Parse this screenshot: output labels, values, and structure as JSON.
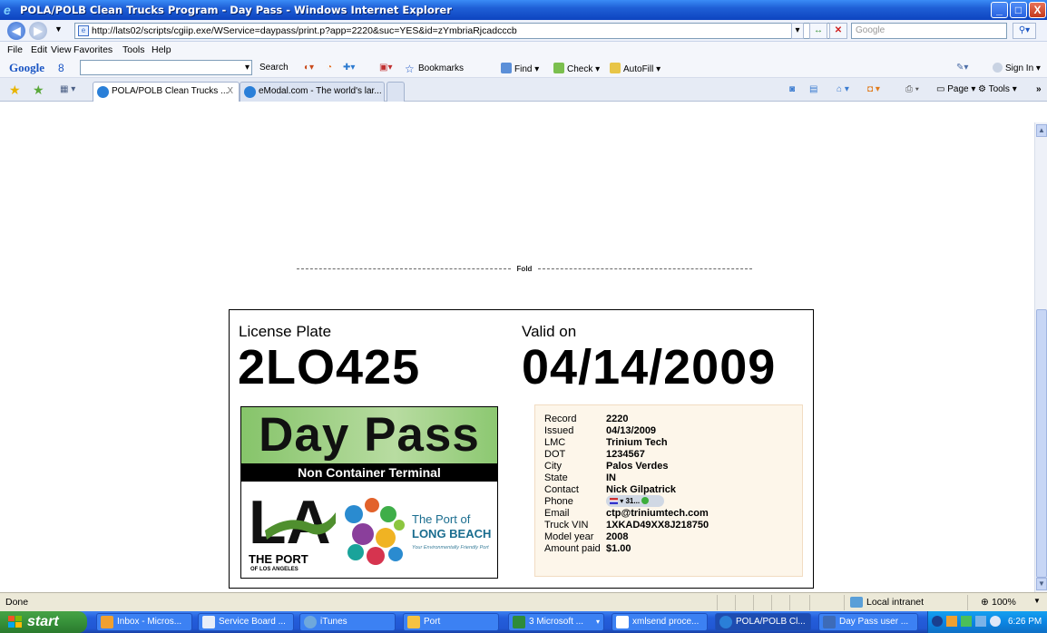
{
  "window": {
    "title": "POLA/POLB Clean Trucks Program - Day Pass - Windows Internet Explorer",
    "buttons": [
      "_",
      "□",
      "X"
    ]
  },
  "address_bar": {
    "url": "http://lats02/scripts/cgiip.exe/WService=daypass/print.p?app=2220&suc=YES&id=zYmbriaRjcadcccb",
    "search_placeholder": "Google"
  },
  "menu": [
    "File",
    "Edit",
    "View",
    "Favorites",
    "Tools",
    "Help"
  ],
  "google_toolbar": {
    "logo": "Google",
    "g_label": "8",
    "search_label": "Search",
    "bookmarks_label": "Bookmarks",
    "find_label": "Find",
    "check_label": "Check",
    "autofill_label": "AutoFill",
    "signin_label": "Sign In"
  },
  "tabs": [
    {
      "label": "POLA/POLB Clean Trucks ...",
      "close": "X",
      "active": true
    },
    {
      "label": "eModal.com - The world's lar...",
      "active": false
    }
  ],
  "command_bar": {
    "page_label": "Page",
    "tools_label": "Tools"
  },
  "page": {
    "fold_label": "Fold",
    "license_plate_label": "License Plate",
    "license_plate": "2LO425",
    "valid_on_label": "Valid on",
    "valid_on": "04/14/2009",
    "day_pass": {
      "title": "Day Pass",
      "subtitle": "Non Container Terminal",
      "la_logo_text": "LA",
      "port_la_line1": "THE PORT",
      "port_la_line2": "OF LOS ANGELES",
      "port_lb_line1": "The Port of",
      "port_lb_line2": "LONG BEACH",
      "port_lb_tagline": "Your Environmentally Friendly Port"
    },
    "details": [
      {
        "key": "Record",
        "value": "2220"
      },
      {
        "key": "Issued",
        "value": "04/13/2009"
      },
      {
        "key": "LMC",
        "value": "Trinium Tech"
      },
      {
        "key": "DOT",
        "value": "1234567"
      },
      {
        "key": "City",
        "value": "Palos Verdes"
      },
      {
        "key": "State",
        "value": "IN"
      },
      {
        "key": "Contact",
        "value": "Nick Gilpatrick"
      },
      {
        "key": "Phone",
        "value": "31..."
      },
      {
        "key": "Email",
        "value": "ctp@triniumtech.com"
      },
      {
        "key": "Truck VIN",
        "value": "1XKAD49XX8J218750"
      },
      {
        "key": "Model year",
        "value": "2008"
      },
      {
        "key": "Amount paid",
        "value": "$1.00"
      }
    ]
  },
  "status_bar": {
    "status": "Done",
    "zone": "Local intranet",
    "zoom": "100%"
  },
  "taskbar": {
    "start_label": "start",
    "buttons": [
      {
        "label": "Inbox - Micros...",
        "color": "#f0a030"
      },
      {
        "label": "Service Board ...",
        "color": "#1b5fcf"
      },
      {
        "label": "iTunes",
        "color": "#6fa8dc"
      },
      {
        "label": "Port",
        "color": "#f5c242"
      },
      {
        "label": "3 Microsoft ...",
        "color": "#2e8b3a"
      },
      {
        "label": "xmlsend proce...",
        "color": "#ffffff"
      },
      {
        "label": "POLA/POLB Cl...",
        "color": "#2a7fd8"
      },
      {
        "label": "Day Pass user ...",
        "color": "#3d6bb8"
      }
    ],
    "clock": "6:26 PM"
  }
}
